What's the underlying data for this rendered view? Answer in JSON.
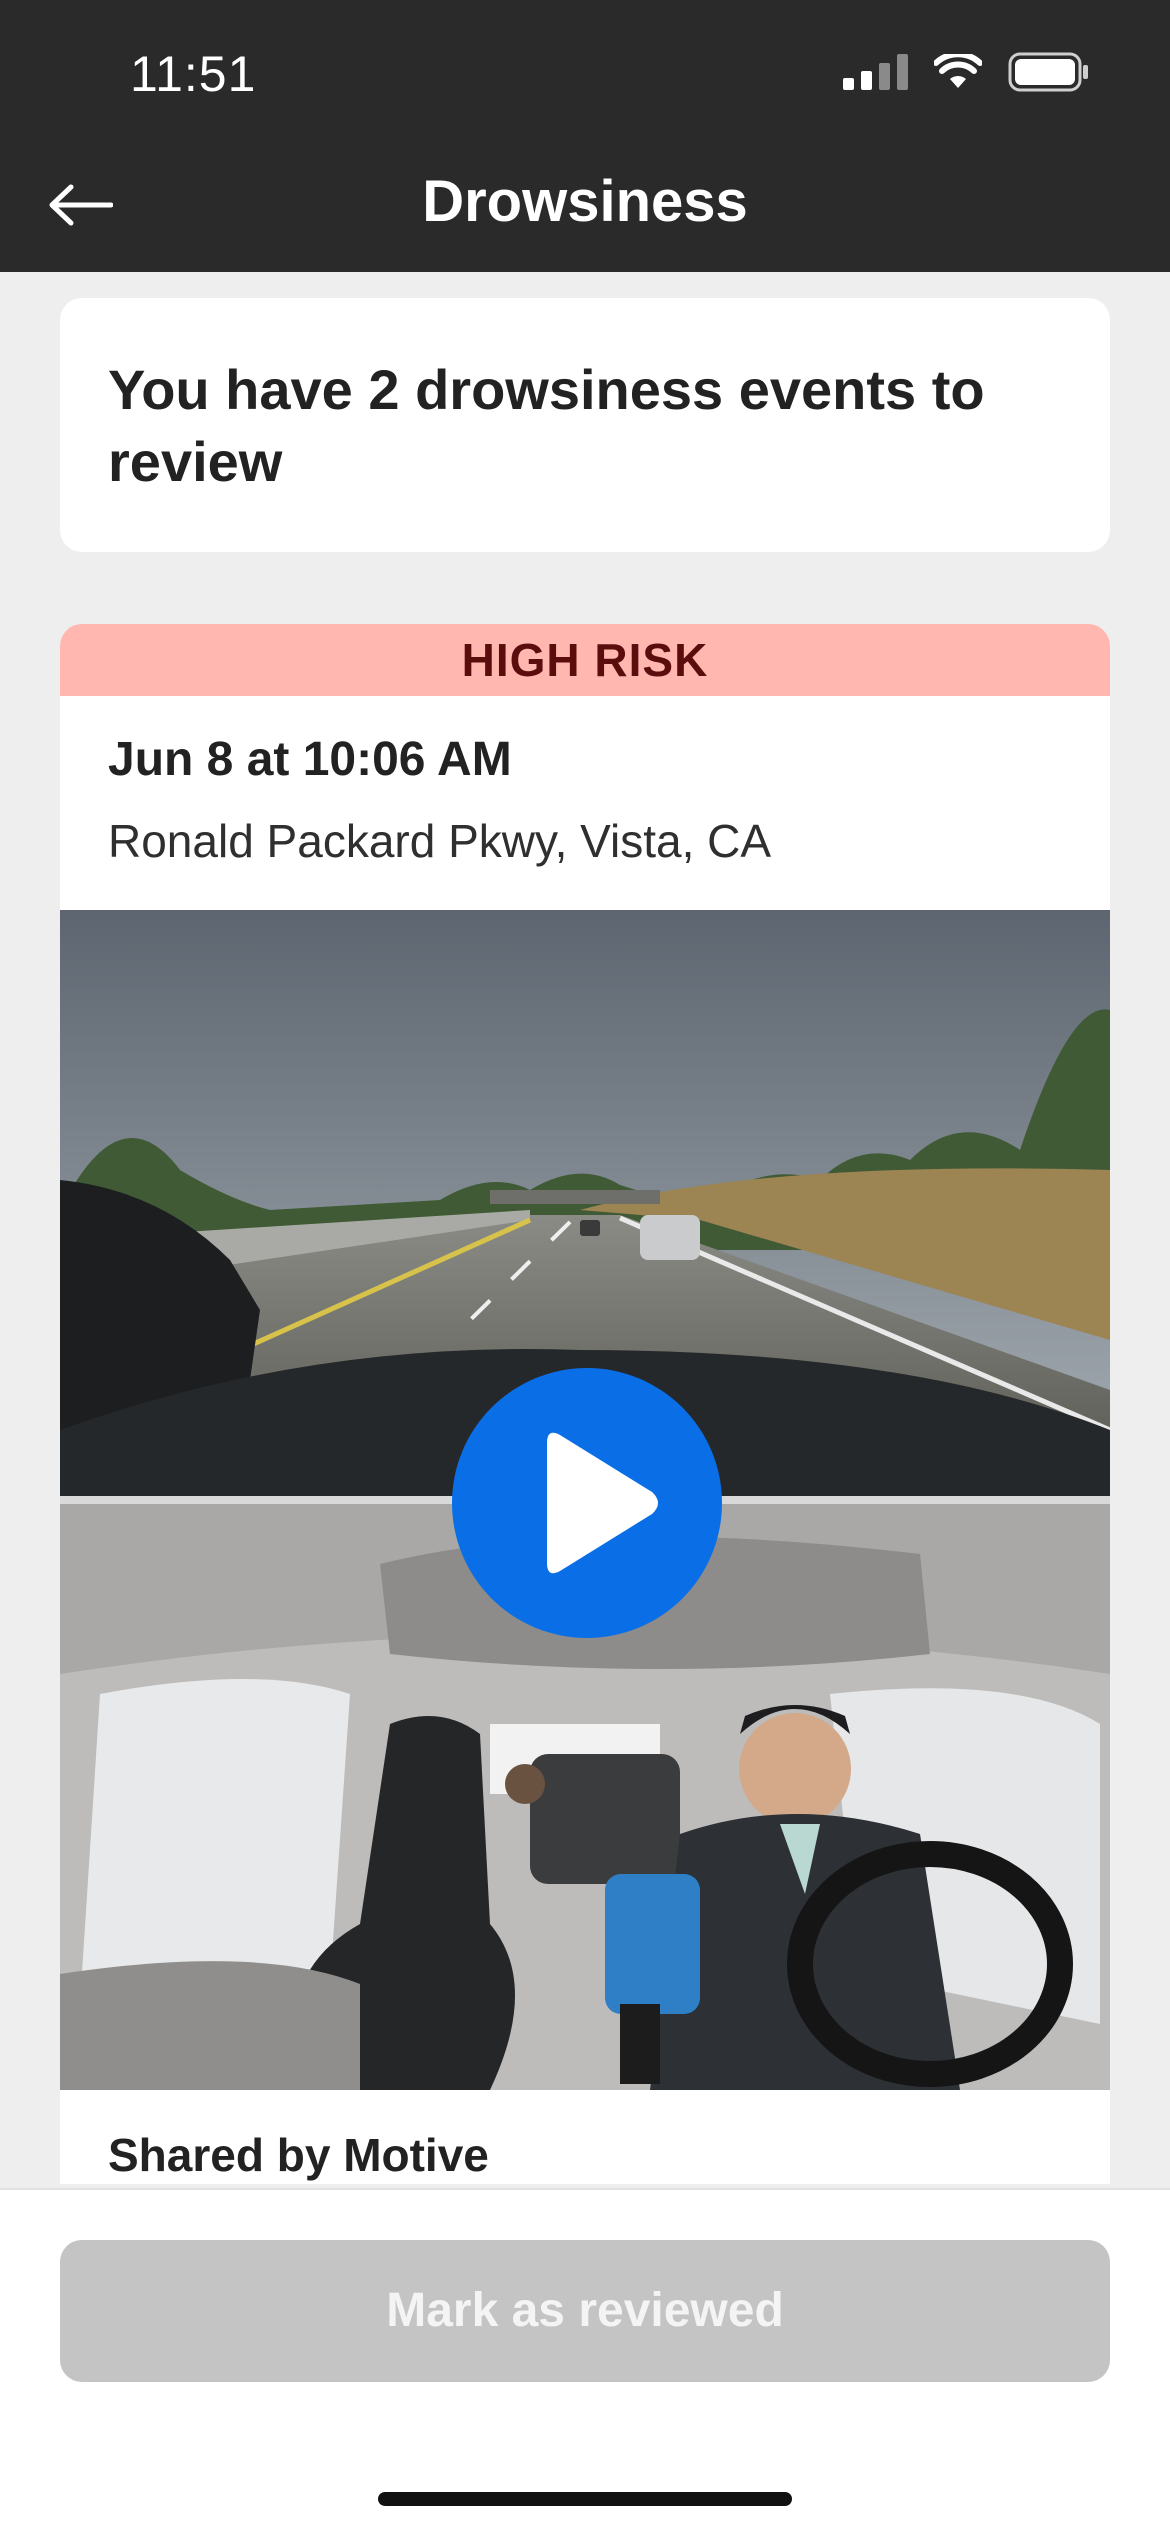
{
  "status_bar": {
    "time": "11:51"
  },
  "nav": {
    "title": "Drowsiness",
    "back_icon": "arrow-left-icon"
  },
  "summary": {
    "text": "You have 2 drowsiness events to review"
  },
  "event": {
    "risk_label": "HIGH RISK",
    "date": "Jun 8 at 10:06 AM",
    "location": "Ronald Packard Pkwy, Vista, CA",
    "shared_by": "Shared by Motive",
    "play_icon": "play-icon"
  },
  "actions": {
    "mark_reviewed_label": "Mark as reviewed"
  },
  "colors": {
    "nav_bg": "#2a2a2a",
    "risk_bg": "#ffb7b0",
    "risk_text": "#5b0d0d",
    "play_blue": "#0a6fe6",
    "button_disabled": "#c4c4c4"
  }
}
